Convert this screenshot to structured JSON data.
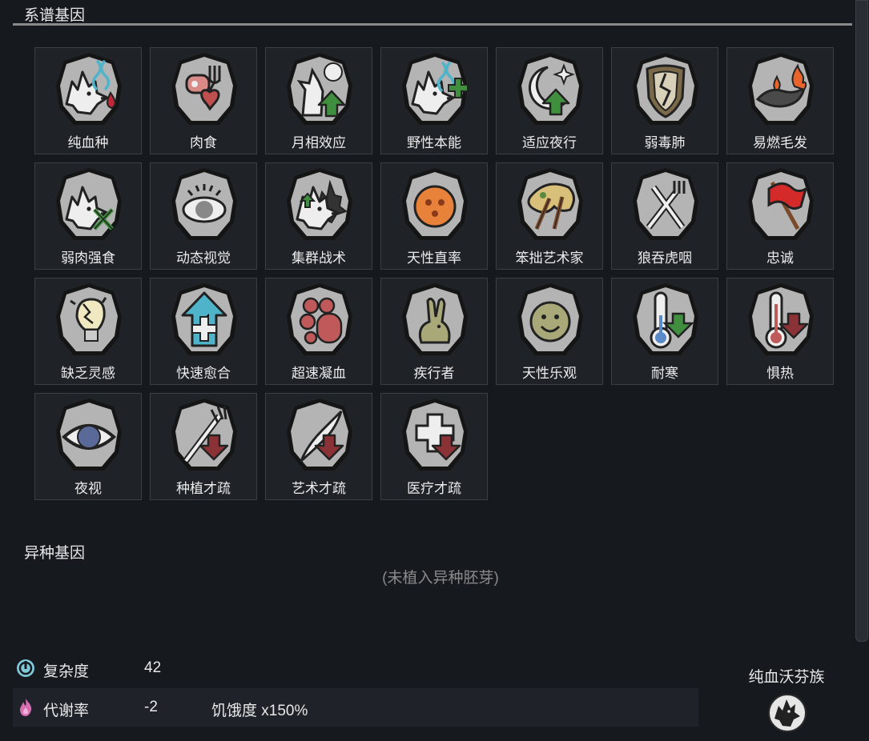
{
  "endogenes": {
    "title": "系谱基因",
    "genes": [
      {
        "label": "纯血种",
        "icon": "wolf-dna-blood-icon"
      },
      {
        "label": "肉食",
        "icon": "meat-fork-heart-icon"
      },
      {
        "label": "月相效应",
        "icon": "wolf-howl-moon-icon"
      },
      {
        "label": "野性本能",
        "icon": "wolf-dna-plus-icon"
      },
      {
        "label": "适应夜行",
        "icon": "crescent-moon-up-arrow-icon"
      },
      {
        "label": "弱毒肺",
        "icon": "cracked-lung-shield-icon"
      },
      {
        "label": "易燃毛发",
        "icon": "burning-fur-icon"
      },
      {
        "label": "弱肉强食",
        "icon": "wolf-crossed-swords-icon"
      },
      {
        "label": "动态视觉",
        "icon": "alert-eye-icon"
      },
      {
        "label": "集群战术",
        "icon": "wolf-pack-icon"
      },
      {
        "label": "天性直率",
        "icon": "blunt-face-icon"
      },
      {
        "label": "笨拙艺术家",
        "icon": "broken-brushes-icon"
      },
      {
        "label": "狼吞虎咽",
        "icon": "knife-fork-icon"
      },
      {
        "label": "忠诚",
        "icon": "red-flag-icon"
      },
      {
        "label": "缺乏灵感",
        "icon": "broken-lightbulb-icon"
      },
      {
        "label": "快速愈合",
        "icon": "healing-arrow-icon"
      },
      {
        "label": "超速凝血",
        "icon": "blood-cells-icon"
      },
      {
        "label": "疾行者",
        "icon": "rabbit-icon"
      },
      {
        "label": "天性乐观",
        "icon": "smiley-face-icon"
      },
      {
        "label": "耐寒",
        "icon": "thermometer-cold-icon"
      },
      {
        "label": "惧热",
        "icon": "thermometer-heat-icon"
      },
      {
        "label": "夜视",
        "icon": "night-eye-icon"
      },
      {
        "label": "种植才疏",
        "icon": "pitchfork-down-icon"
      },
      {
        "label": "艺术才疏",
        "icon": "brush-down-icon"
      },
      {
        "label": "医疗才疏",
        "icon": "medical-down-icon"
      }
    ]
  },
  "xenogenes": {
    "title": "异种基因",
    "empty_text": "(未植入异种胚芽)"
  },
  "stats": {
    "complexity": {
      "label": "复杂度",
      "value": "42",
      "icon": "complexity-icon"
    },
    "metabolism": {
      "label": "代谢率",
      "value": "-2",
      "note": "饥饿度 x150%",
      "icon": "metabolism-flame-icon"
    }
  },
  "xenotype": {
    "name": "纯血沃芬族",
    "icon": "wolf-head-icon"
  },
  "colors": {
    "background": "#16191e",
    "tile": "#1f2227",
    "green_arrow": "#3f8f3f",
    "red_arrow": "#8a3236",
    "teal": "#4fb3c9",
    "flag_red": "#d42a2a"
  }
}
